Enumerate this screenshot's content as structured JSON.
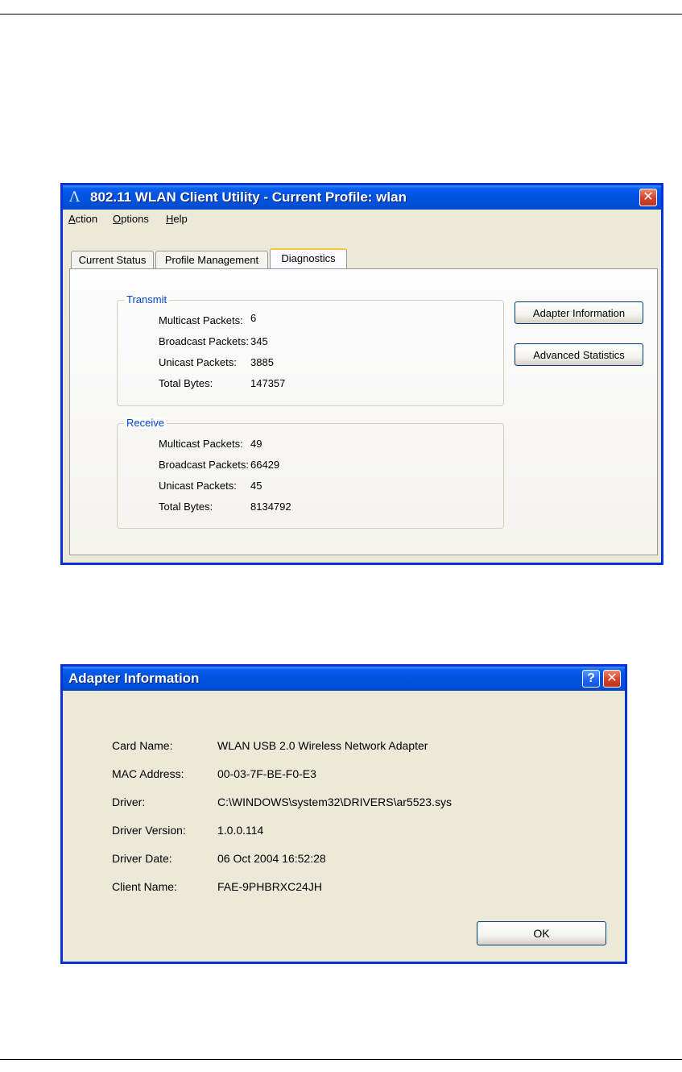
{
  "main_window": {
    "title": "802.11 WLAN Client Utility - Current Profile: wlan",
    "logo_glyph": "Λ",
    "close_glyph": "✕",
    "menu": [
      "Action",
      "Options",
      "Help"
    ],
    "tabs": [
      "Current Status",
      "Profile Management",
      "Diagnostics"
    ],
    "active_tab": 2,
    "transmit": {
      "label": "Transmit",
      "rows": [
        {
          "label": "Multicast Packets:",
          "value": "6"
        },
        {
          "label": "Broadcast Packets:",
          "value": "345"
        },
        {
          "label": "Unicast Packets:",
          "value": "3885"
        },
        {
          "label": "Total Bytes:",
          "value": "147357"
        }
      ]
    },
    "receive": {
      "label": "Receive",
      "rows": [
        {
          "label": "Multicast Packets:",
          "value": "49"
        },
        {
          "label": "Broadcast Packets:",
          "value": "66429"
        },
        {
          "label": "Unicast Packets:",
          "value": "45"
        },
        {
          "label": "Total Bytes:",
          "value": "8134792"
        }
      ]
    },
    "buttons": {
      "adapter_information": "Adapter Information",
      "advanced_statistics": "Advanced Statistics"
    }
  },
  "adapter_dialog": {
    "title": "Adapter Information",
    "help_glyph": "?",
    "close_glyph": "✕",
    "rows": [
      {
        "label": "Card Name:",
        "value": "WLAN USB 2.0 Wireless Network Adapter"
      },
      {
        "label": "MAC Address:",
        "value": "00-03-7F-BE-F0-E3"
      },
      {
        "label": "Driver:",
        "value": "C:\\WINDOWS\\system32\\DRIVERS\\ar5523.sys"
      },
      {
        "label": "Driver Version:",
        "value": "1.0.0.114"
      },
      {
        "label": "Driver Date:",
        "value": "06 Oct 2004 16:52:28"
      },
      {
        "label": "Client Name:",
        "value": "FAE-9PHBRXC24JH"
      }
    ],
    "ok_label": "OK"
  },
  "colors": {
    "titlebar": "#0054e3",
    "window_bg": "#ece9d8",
    "group_label": "#0046d5",
    "tab_highlight": "#ffc83c"
  }
}
